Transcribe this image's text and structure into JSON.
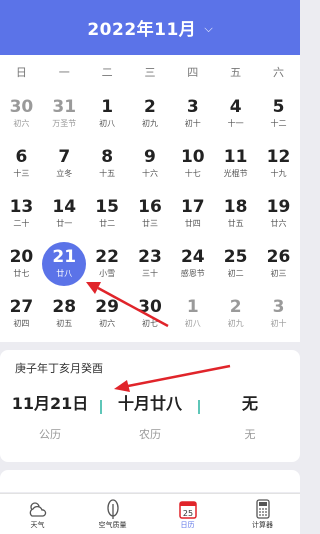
{
  "header": {
    "title": "2022年11月"
  },
  "weekdays": [
    "日",
    "一",
    "二",
    "三",
    "四",
    "五",
    "六"
  ],
  "days": [
    {
      "n": "30",
      "l": "初六",
      "dim": true
    },
    {
      "n": "31",
      "l": "万圣节",
      "dim": true
    },
    {
      "n": "1",
      "l": "初八"
    },
    {
      "n": "2",
      "l": "初九"
    },
    {
      "n": "3",
      "l": "初十"
    },
    {
      "n": "4",
      "l": "十一"
    },
    {
      "n": "5",
      "l": "十二"
    },
    {
      "n": "6",
      "l": "十三"
    },
    {
      "n": "7",
      "l": "立冬"
    },
    {
      "n": "8",
      "l": "十五"
    },
    {
      "n": "9",
      "l": "十六"
    },
    {
      "n": "10",
      "l": "十七"
    },
    {
      "n": "11",
      "l": "光棍节"
    },
    {
      "n": "12",
      "l": "十九"
    },
    {
      "n": "13",
      "l": "二十"
    },
    {
      "n": "14",
      "l": "廿一"
    },
    {
      "n": "15",
      "l": "廿二"
    },
    {
      "n": "16",
      "l": "廿三"
    },
    {
      "n": "17",
      "l": "廿四"
    },
    {
      "n": "18",
      "l": "廿五"
    },
    {
      "n": "19",
      "l": "廿六"
    },
    {
      "n": "20",
      "l": "廿七"
    },
    {
      "n": "21",
      "l": "廿八",
      "sel": true
    },
    {
      "n": "22",
      "l": "小雪"
    },
    {
      "n": "23",
      "l": "三十"
    },
    {
      "n": "24",
      "l": "感恩节"
    },
    {
      "n": "25",
      "l": "初二"
    },
    {
      "n": "26",
      "l": "初三"
    },
    {
      "n": "27",
      "l": "初四"
    },
    {
      "n": "28",
      "l": "初五"
    },
    {
      "n": "29",
      "l": "初六"
    },
    {
      "n": "30",
      "l": "初七"
    },
    {
      "n": "1",
      "l": "初八",
      "dim": true
    },
    {
      "n": "2",
      "l": "初九",
      "dim": true
    },
    {
      "n": "3",
      "l": "初十",
      "dim": true
    }
  ],
  "info": {
    "ganzhi": "庚子年丁亥月癸酉",
    "solar_value": "11月21日",
    "solar_label": "公历",
    "lunar_value": "十月廿八",
    "lunar_label": "农历",
    "festival_value": "无",
    "festival_label": "无"
  },
  "tabs": [
    {
      "label": "天气",
      "icon": "weather-icon"
    },
    {
      "label": "空气质量",
      "icon": "air-quality-icon"
    },
    {
      "label": "日历",
      "icon": "calendar-icon",
      "active": true,
      "icon_text": "25"
    },
    {
      "label": "计算器",
      "icon": "calculator-icon"
    }
  ],
  "colors": {
    "accent": "#5b73e8",
    "annotation_arrow": "#e0242a",
    "separator": "#5ec6b8"
  }
}
